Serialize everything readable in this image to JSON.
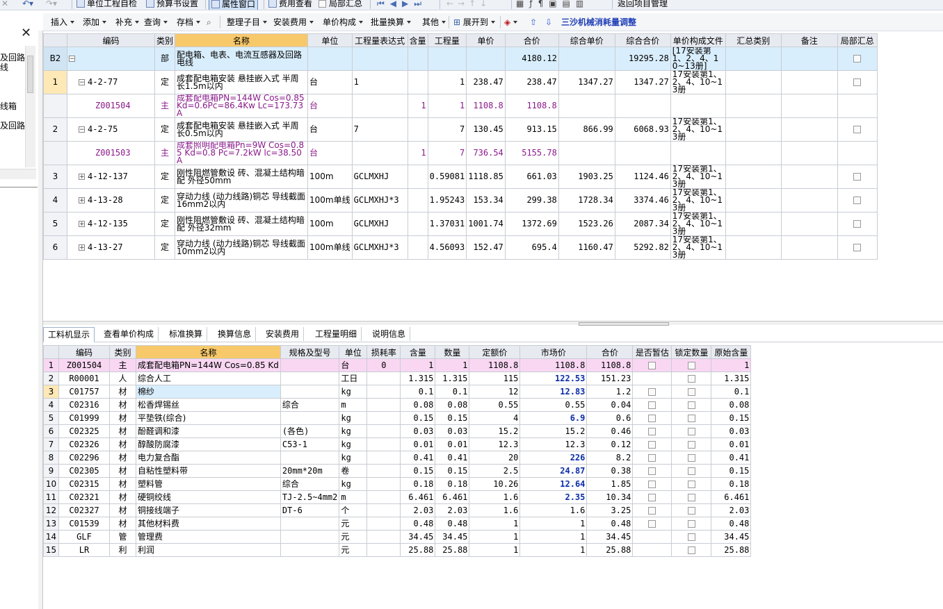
{
  "toolbar1": {
    "selfcheck": "单位工程自检",
    "budget": "预算书设置",
    "attr": "属性窗口",
    "fee": "费用查看",
    "local_sum": "局部汇总",
    "back": "返回项目管理"
  },
  "toolbar2": {
    "insert": "插入",
    "add": "添加",
    "supplement": "补充",
    "query": "查询",
    "archive": "存档",
    "tidy": "整理子目",
    "install_fee": "安装费用",
    "unit_price": "单价构成",
    "batch": "批量换算",
    "other": "其他",
    "expand": "展开到",
    "sansha": "三沙机械消耗量调整"
  },
  "left_tree": [
    "及回路",
    "线",
    "",
    "线箱",
    "及回路"
  ],
  "grid1": {
    "headers": [
      "编码",
      "类别",
      "名称",
      "单位",
      "工程量表达式",
      "含量",
      "工程量",
      "单价",
      "合价",
      "综合单价",
      "综合合价",
      "单价构成文件",
      "汇总类别",
      "备注",
      "局部汇总"
    ],
    "rows": [
      {
        "rn": "B2",
        "tree": "minus",
        "code": "",
        "type": "部",
        "name": "配电箱、电表、电流互感器及回路电线",
        "unit": "",
        "expr": "",
        "content": "",
        "qty": "",
        "price": "",
        "total": "4180.12",
        "cprice": "",
        "ctotal": "19295.28",
        "file": "[17安装第1、2、4、10~13册]",
        "cat": "",
        "note": "",
        "sum": true
      },
      {
        "rn": "1",
        "tree": "minus",
        "code": "4-2-77",
        "type": "定",
        "name": "成套配电箱安装 悬挂嵌入式 半周长1.5m以内",
        "unit": "台",
        "expr": "1",
        "content": "",
        "qty": "1",
        "price": "238.47",
        "total": "238.47",
        "cprice": "1347.27",
        "ctotal": "1347.27",
        "file": "17安装第1、2、4、10~13册",
        "cat": "",
        "note": "",
        "sum": true
      },
      {
        "rn": "",
        "tree": "",
        "code": "Z001504",
        "type": "主",
        "name": "成套配电箱PN=144W Cos=0.85 Kd=0.6Pc=86.4Kw Lc=173.73A",
        "unit": "台",
        "expr": "",
        "content": "1",
        "qty": "1",
        "price": "1108.8",
        "total": "1108.8",
        "cprice": "",
        "ctotal": "",
        "file": "",
        "cat": "",
        "note": "",
        "sum": false
      },
      {
        "rn": "2",
        "tree": "minus",
        "code": "4-2-75",
        "type": "定",
        "name": "成套配电箱安装 悬挂嵌入式 半周长0.5m以内",
        "unit": "台",
        "expr": "7",
        "content": "",
        "qty": "7",
        "price": "130.45",
        "total": "913.15",
        "cprice": "866.99",
        "ctotal": "6068.93",
        "file": "17安装第1、2、4、10~13册",
        "cat": "",
        "note": "",
        "sum": true
      },
      {
        "rn": "",
        "tree": "",
        "code": "Z001503",
        "type": "主",
        "name": "成套照明配电箱Pn=9W Cos=0.85 Kd=0.8 Pc=7.2kW lc=38.50A",
        "unit": "台",
        "expr": "",
        "content": "1",
        "qty": "7",
        "price": "736.54",
        "total": "5155.78",
        "cprice": "",
        "ctotal": "",
        "file": "",
        "cat": "",
        "note": "",
        "sum": false
      },
      {
        "rn": "3",
        "tree": "plus",
        "code": "4-12-137",
        "type": "定",
        "name": "刚性阻燃管敷设 砖、混凝土结构暗配 外径50mm",
        "unit": "100m",
        "expr": "GCLMXHJ",
        "content": "",
        "qty": "0.59081",
        "price": "1118.85",
        "total": "661.03",
        "cprice": "1903.25",
        "ctotal": "1124.46",
        "file": "17安装第1、2、4、10~13册",
        "cat": "",
        "note": "",
        "sum": true
      },
      {
        "rn": "4",
        "tree": "plus",
        "code": "4-13-28",
        "type": "定",
        "name": "穿动力线 (动力线路)铜芯 导线截面 16mm2以内",
        "unit": "100m单线",
        "expr": "GCLMXHJ*3",
        "content": "",
        "qty": "1.95243",
        "price": "153.34",
        "total": "299.38",
        "cprice": "1728.34",
        "ctotal": "3374.46",
        "file": "17安装第1、2、4、10~13册",
        "cat": "",
        "note": "",
        "sum": true
      },
      {
        "rn": "5",
        "tree": "plus",
        "code": "4-12-135",
        "type": "定",
        "name": "刚性阻燃管敷设 砖、混凝土结构暗配 外径32mm",
        "unit": "100m",
        "expr": "GCLMXHJ",
        "content": "",
        "qty": "1.37031",
        "price": "1001.74",
        "total": "1372.69",
        "cprice": "1523.26",
        "ctotal": "2087.34",
        "file": "17安装第1、2、4、10~13册",
        "cat": "",
        "note": "",
        "sum": true
      },
      {
        "rn": "6",
        "tree": "plus",
        "code": "4-13-27",
        "type": "定",
        "name": "穿动力线 (动力线路)铜芯 导线截面 10mm2以内",
        "unit": "100m单线",
        "expr": "GCLMXHJ*3",
        "content": "",
        "qty": "4.56093",
        "price": "152.47",
        "total": "695.4",
        "cprice": "1160.47",
        "ctotal": "5292.82",
        "file": "17安装第1、2、4、10~13册",
        "cat": "",
        "note": "",
        "sum": true
      }
    ]
  },
  "tabs": [
    "工料机显示",
    "查看单价构成",
    "标准换算",
    "换算信息",
    "安装费用",
    "工程量明细",
    "说明信息"
  ],
  "grid2": {
    "headers": [
      "编码",
      "类别",
      "名称",
      "规格及型号",
      "单位",
      "损耗率",
      "含量",
      "数量",
      "定额价",
      "市场价",
      "合价",
      "是否暂估",
      "锁定数量",
      "原始含量"
    ],
    "rows": [
      {
        "rn": "1",
        "code": "Z001504",
        "type": "主",
        "name": "成套配电箱PN=144W Cos=0.85 Kd",
        "spec": "",
        "unit": "台",
        "loss": "0",
        "content": "1",
        "qty": "1",
        "base": "1108.8",
        "market": "1108.8",
        "blue": false,
        "total": "1108.8",
        "est": true,
        "lock": true,
        "orig": "1"
      },
      {
        "rn": "2",
        "code": "R00001",
        "type": "人",
        "name": "综合人工",
        "spec": "",
        "unit": "工日",
        "loss": "",
        "content": "1.315",
        "qty": "1.315",
        "base": "115",
        "market": "122.53",
        "blue": true,
        "total": "151.23",
        "est": false,
        "lock": true,
        "orig": "1.315"
      },
      {
        "rn": "3",
        "code": "C01757",
        "type": "材",
        "name": "棉纱",
        "spec": "",
        "unit": "kg",
        "loss": "",
        "content": "0.1",
        "qty": "0.1",
        "base": "12",
        "market": "12.83",
        "blue": true,
        "total": "1.2",
        "est": true,
        "lock": true,
        "orig": "0.1"
      },
      {
        "rn": "4",
        "code": "C02316",
        "type": "材",
        "name": "松香焊锡丝",
        "spec": "综合",
        "unit": "m",
        "loss": "",
        "content": "0.08",
        "qty": "0.08",
        "base": "0.55",
        "market": "0.55",
        "blue": false,
        "total": "0.04",
        "est": true,
        "lock": true,
        "orig": "0.08"
      },
      {
        "rn": "5",
        "code": "C01999",
        "type": "材",
        "name": "平垫铁(综合)",
        "spec": "",
        "unit": "kg",
        "loss": "",
        "content": "0.15",
        "qty": "0.15",
        "base": "4",
        "market": "6.9",
        "blue": true,
        "total": "0.6",
        "est": true,
        "lock": true,
        "orig": "0.15"
      },
      {
        "rn": "6",
        "code": "C02325",
        "type": "材",
        "name": "酚醛调和漆",
        "spec": "(各色)",
        "unit": "kg",
        "loss": "",
        "content": "0.03",
        "qty": "0.03",
        "base": "15.2",
        "market": "15.2",
        "blue": false,
        "total": "0.46",
        "est": true,
        "lock": true,
        "orig": "0.03"
      },
      {
        "rn": "7",
        "code": "C02326",
        "type": "材",
        "name": "醇酸防腐漆",
        "spec": "C53-1",
        "unit": "kg",
        "loss": "",
        "content": "0.01",
        "qty": "0.01",
        "base": "12.3",
        "market": "12.3",
        "blue": false,
        "total": "0.12",
        "est": true,
        "lock": true,
        "orig": "0.01"
      },
      {
        "rn": "8",
        "code": "C02296",
        "type": "材",
        "name": "电力复合酯",
        "spec": "",
        "unit": "kg",
        "loss": "",
        "content": "0.41",
        "qty": "0.41",
        "base": "20",
        "market": "226",
        "blue": true,
        "total": "8.2",
        "est": true,
        "lock": true,
        "orig": "0.41"
      },
      {
        "rn": "9",
        "code": "C02305",
        "type": "材",
        "name": "自粘性塑料带",
        "spec": "20mm*20m",
        "unit": "卷",
        "loss": "",
        "content": "0.15",
        "qty": "0.15",
        "base": "2.5",
        "market": "24.87",
        "blue": true,
        "total": "0.38",
        "est": true,
        "lock": true,
        "orig": "0.15"
      },
      {
        "rn": "10",
        "code": "C02315",
        "type": "材",
        "name": "塑料管",
        "spec": "综合",
        "unit": "kg",
        "loss": "",
        "content": "0.18",
        "qty": "0.18",
        "base": "10.26",
        "market": "12.64",
        "blue": true,
        "total": "1.85",
        "est": true,
        "lock": true,
        "orig": "0.18"
      },
      {
        "rn": "11",
        "code": "C02321",
        "type": "材",
        "name": "硬铜绞线",
        "spec": "TJ-2.5~4mm2",
        "unit": "m",
        "loss": "",
        "content": "6.461",
        "qty": "6.461",
        "base": "1.6",
        "market": "2.35",
        "blue": true,
        "total": "10.34",
        "est": true,
        "lock": true,
        "orig": "6.461"
      },
      {
        "rn": "12",
        "code": "C02327",
        "type": "材",
        "name": "铜接线端子",
        "spec": "DT-6",
        "unit": "个",
        "loss": "",
        "content": "2.03",
        "qty": "2.03",
        "base": "1.6",
        "market": "1.6",
        "blue": false,
        "total": "3.25",
        "est": true,
        "lock": true,
        "orig": "2.03"
      },
      {
        "rn": "13",
        "code": "C01539",
        "type": "材",
        "name": "其他材料费",
        "spec": "",
        "unit": "元",
        "loss": "",
        "content": "0.48",
        "qty": "0.48",
        "base": "1",
        "market": "1",
        "blue": false,
        "total": "0.48",
        "est": true,
        "lock": true,
        "orig": "0.48"
      },
      {
        "rn": "14",
        "code": "GLF",
        "type": "管",
        "name": "管理费",
        "spec": "",
        "unit": "元",
        "loss": "",
        "content": "34.45",
        "qty": "34.45",
        "base": "1",
        "market": "1",
        "blue": false,
        "total": "34.45",
        "est": false,
        "lock": true,
        "orig": "34.45"
      },
      {
        "rn": "15",
        "code": "LR",
        "type": "利",
        "name": "利润",
        "spec": "",
        "unit": "元",
        "loss": "",
        "content": "25.88",
        "qty": "25.88",
        "base": "1",
        "market": "1",
        "blue": false,
        "total": "25.88",
        "est": false,
        "lock": true,
        "orig": "25.88"
      }
    ]
  }
}
